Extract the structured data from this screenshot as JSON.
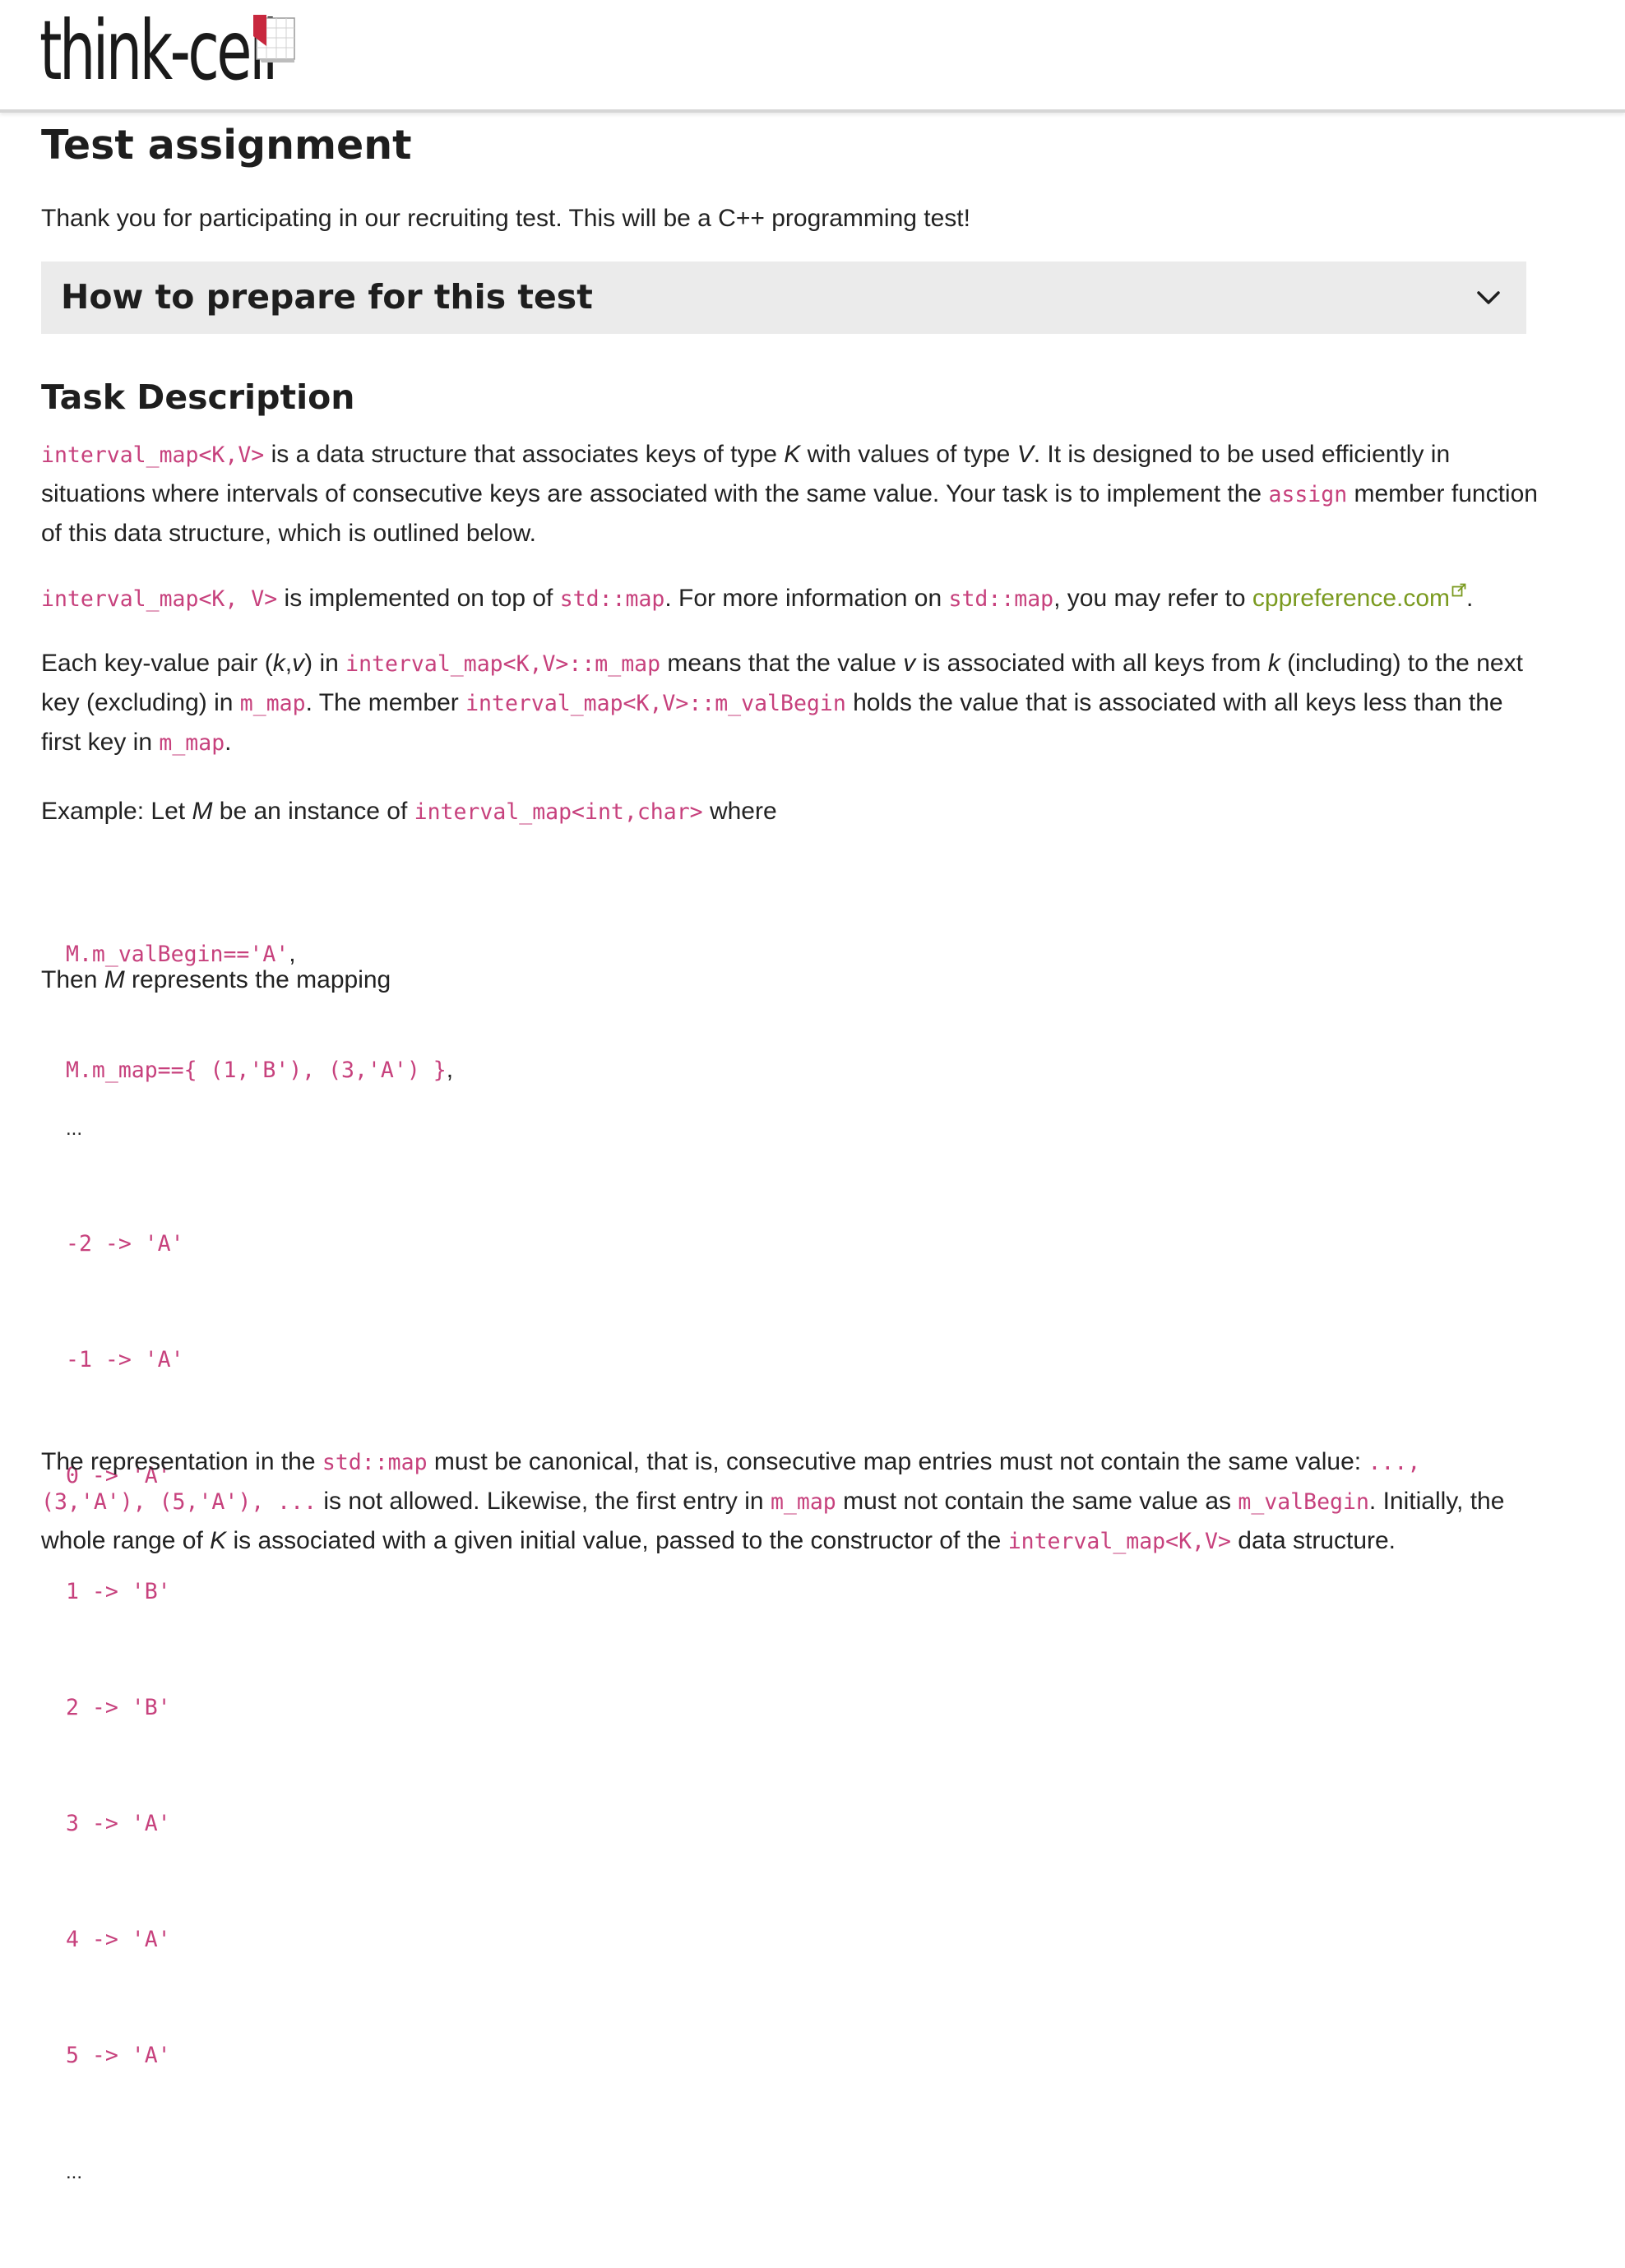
{
  "header": {
    "logo_text": "think-cell"
  },
  "page": {
    "title": "Test assignment",
    "intro": "Thank you for participating in our recruiting test. This will be a C++ programming test!"
  },
  "accordion": {
    "title": "How to prepare for this test",
    "icon": "chevron-down-icon"
  },
  "task": {
    "heading": "Task Description",
    "p1": {
      "c1": "interval_map<K,V>",
      "t1": " is a data structure that associates keys of type ",
      "i1": "K",
      "t2": " with values of type ",
      "i2": "V",
      "t3": ". It is designed to be used efficiently in situations where intervals of consecutive keys are associated with the same value. Your task is to implement the ",
      "c2": "assign",
      "t4": " member function of this data structure, which is outlined below."
    },
    "p2": {
      "c1": "interval_map<K, V>",
      "t1": " is implemented on top of ",
      "c2": "std::map",
      "t2": ". For more information on ",
      "c3": "std::map",
      "t3": ", you may refer to ",
      "link": "cppreference.com",
      "t4": "."
    },
    "p3": {
      "t1": "Each key-value pair (",
      "i1": "k",
      "t2": ",",
      "i2": "v",
      "t3": ") in ",
      "c1": "interval_map<K,V>::m_map",
      "t4": " means that the value ",
      "i3": "v",
      "t5": " is associated with all keys from ",
      "i4": "k",
      "t6": " (including) to the next key (excluding) in ",
      "c2": "m_map",
      "t7": ". The member ",
      "c3": "interval_map<K,V>::m_valBegin",
      "t8": " holds the value that is associated with all keys less than the first key in ",
      "c4": "m_map",
      "t9": "."
    },
    "p4": {
      "t1": "Example: Let ",
      "i1": "M",
      "t2": " be an instance of ",
      "c1": "interval_map<int,char>",
      "t3": " where"
    },
    "example_code": {
      "line1": "M.m_valBegin=='A'",
      "line1_suffix": ",",
      "line2": "M.m_map=={ (1,'B'), (3,'A') }",
      "line2_suffix": ","
    },
    "p5": {
      "t1": "Then ",
      "i1": "M",
      "t2": " represents the mapping"
    },
    "mapping": {
      "dots_top": "...",
      "lines": [
        "-2 -> 'A'",
        "-1 -> 'A'",
        "0 -> 'A'",
        "1 -> 'B'",
        "2 -> 'B'",
        "3 -> 'A'",
        "4 -> 'A'",
        "5 -> 'A'"
      ],
      "dots_bottom": "..."
    },
    "p6": {
      "t1": "The representation in the ",
      "c1": "std::map",
      "t2": " must be canonical, that is, consecutive map entries must not contain the same value: ",
      "c2": "..., (3,'A'), (5,'A'), ...",
      "t3": " is not allowed. Likewise, the first entry in ",
      "c3": "m_map",
      "t4": " must not contain the same value as ",
      "c4": "m_valBegin",
      "t5": ". Initially, the whole range of ",
      "i1": "K",
      "t6": " is associated with a given initial value, passed to the constructor of the ",
      "c5": "interval_map<K,V>",
      "t7": " data structure."
    }
  },
  "colors": {
    "code": "#c7417d",
    "link": "#7a9a1f",
    "logo_red": "#c8283e",
    "accordion_bg": "#ebebeb"
  }
}
